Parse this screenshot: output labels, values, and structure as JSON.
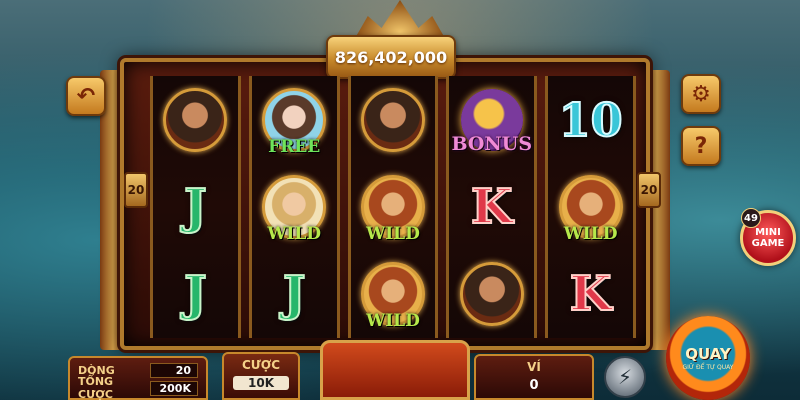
{
  "jackpot": {
    "value": "826,402,000"
  },
  "paylines": {
    "left": "20",
    "right": "20"
  },
  "reels": [
    [
      {
        "kind": "portrait",
        "variant": "warrior",
        "icon": "warrior-symbol"
      },
      {
        "kind": "letter",
        "variant": "j",
        "text": "J",
        "icon": "letter-j-symbol"
      },
      {
        "kind": "letter",
        "variant": "j",
        "text": "J",
        "icon": "letter-j-symbol"
      }
    ],
    [
      {
        "kind": "free",
        "variant": "lady",
        "text": "FREE",
        "icon": "free-spin-symbol"
      },
      {
        "kind": "wild",
        "variant": "monk",
        "text": "WILD",
        "icon": "wild-symbol"
      },
      {
        "kind": "letter",
        "variant": "j",
        "text": "J",
        "icon": "letter-j-symbol"
      }
    ],
    [
      {
        "kind": "portrait",
        "variant": "warrior",
        "icon": "warrior-symbol"
      },
      {
        "kind": "wild",
        "variant": "monkey",
        "text": "WILD",
        "icon": "wild-symbol"
      },
      {
        "kind": "wild",
        "variant": "monkey",
        "text": "WILD",
        "icon": "wild-symbol"
      }
    ],
    [
      {
        "kind": "bonus",
        "text": "BONUS",
        "icon": "bonus-symbol"
      },
      {
        "kind": "letter",
        "variant": "k",
        "text": "K",
        "icon": "letter-k-symbol"
      },
      {
        "kind": "portrait",
        "variant": "warrior",
        "icon": "warrior-symbol"
      }
    ],
    [
      {
        "kind": "letter",
        "variant": "ten",
        "text": "10",
        "icon": "ten-symbol"
      },
      {
        "kind": "wild",
        "variant": "monkey",
        "text": "WILD",
        "icon": "wild-symbol"
      },
      {
        "kind": "letter",
        "variant": "k",
        "text": "K",
        "icon": "letter-k-symbol"
      }
    ]
  ],
  "buttons": {
    "back_glyph": "↶",
    "settings_glyph": "⚙",
    "help_glyph": "?",
    "turbo_glyph": "⚡"
  },
  "minigame": {
    "badge": "49",
    "line1": "MINI",
    "line2": "GAME"
  },
  "panel": {
    "lines_label": "DÒNG",
    "lines_value": "20",
    "total_bet_label": "TỔNG CƯỢC",
    "total_bet_value": "200K",
    "bet_label": "CƯỢC",
    "bet_value": "10K",
    "wallet_label": "VÍ",
    "wallet_value": "0"
  },
  "spin": {
    "label": "QUAY",
    "sub": "GIỮ ĐỂ TỰ QUAY"
  },
  "colors": {
    "gold": "#d8a24a",
    "frame": "#5a1c0e",
    "wild": "#b6e84b"
  }
}
